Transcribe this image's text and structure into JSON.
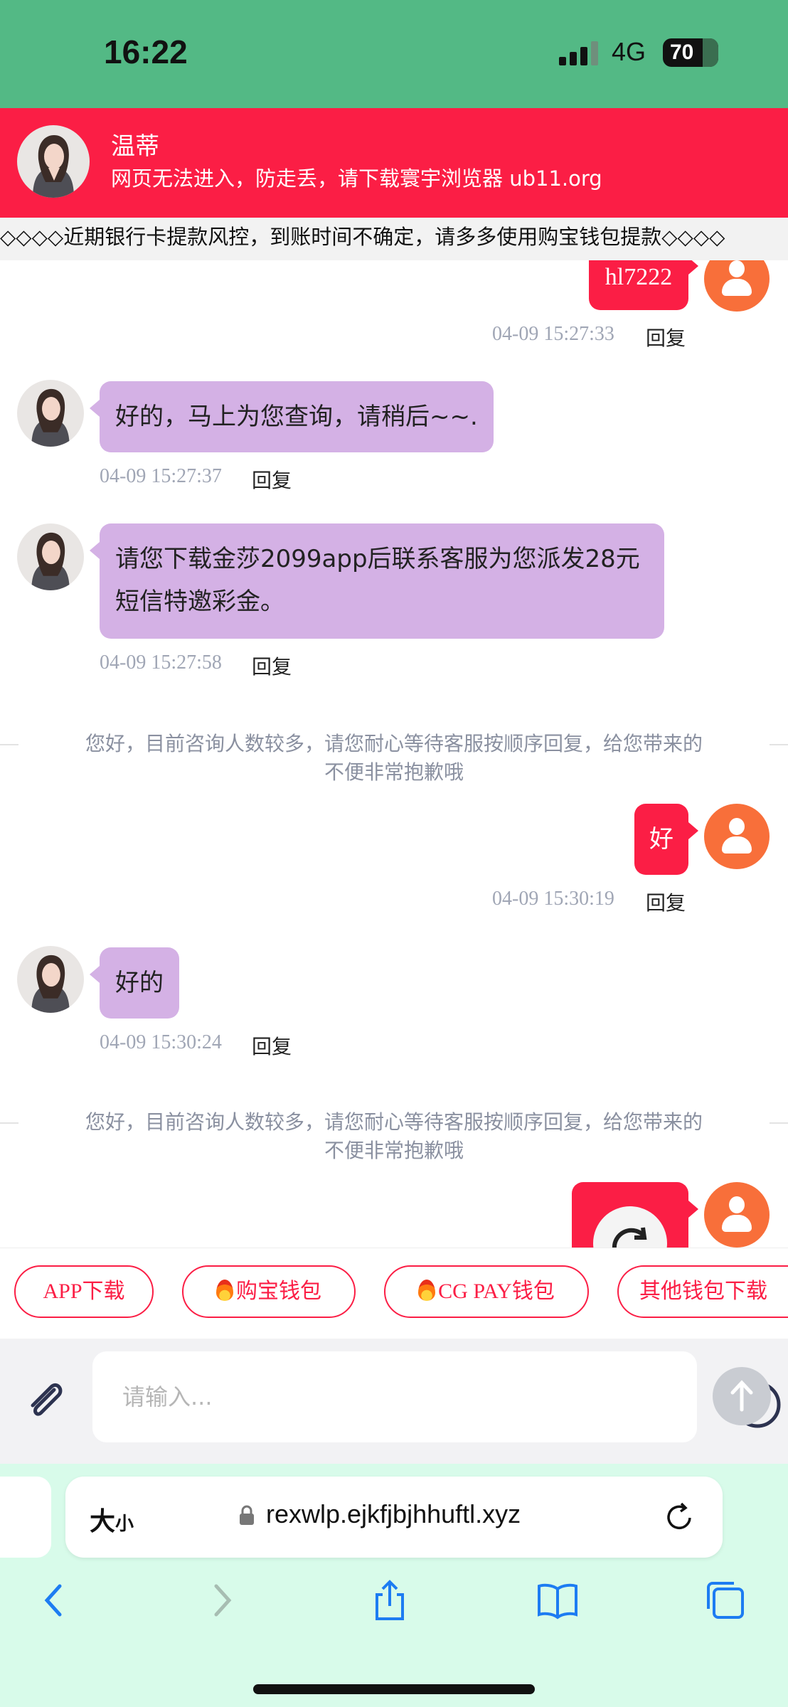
{
  "status": {
    "time": "16:22",
    "network": "4G",
    "battery": "70"
  },
  "header": {
    "agent_name": "温蒂",
    "notice": "网页无法进入，防走丢，请下载寰宇浏览器 ub11.org"
  },
  "marquee": "◇◇◇◇近期银行卡提款风控，到账时间不确定，请多多使用购宝钱包提款◇◇◇◇",
  "messages": {
    "m1": {
      "text": "hl7222",
      "time": "04-09 15:27:33",
      "reply": "回复"
    },
    "m2": {
      "text": "好的，马上为您查询，请稍后~~.",
      "time": "04-09 15:27:37",
      "reply": "回复"
    },
    "m3": {
      "line1": "请您下载金莎2099app后联系客服为您派发28元",
      "line2": "短信特邀彩金。",
      "time": "04-09 15:27:58",
      "reply": "回复"
    },
    "sys1": {
      "line1": "您好，目前咨询人数较多，请您耐心等待客服按顺序回复，给您带来的",
      "line2": "不便非常抱歉哦"
    },
    "m4": {
      "text": "好",
      "time": "04-09 15:30:19",
      "reply": "回复"
    },
    "m5": {
      "text": "好的",
      "time": "04-09 15:30:24",
      "reply": "回复"
    },
    "sys2": {
      "line1": "您好，目前咨询人数较多，请您耐心等待客服按顺序回复，给您带来的",
      "line2": "不便非常抱歉哦"
    }
  },
  "quick_buttons": {
    "b1": "APP下载",
    "b2": "购宝钱包",
    "b3": "CG PAY钱包",
    "b4": "其他钱包下载"
  },
  "input": {
    "placeholder": "请输入..."
  },
  "browser": {
    "aa_big": "大",
    "aa_small": "小",
    "url": "rexwlp.ejkfjbjhhuftl.xyz"
  },
  "icons": {
    "attach": "paperclip-icon",
    "emoji": "smiley-icon",
    "send": "arrow-up-icon",
    "back": "chevron-left-icon",
    "forward": "chevron-right-icon",
    "share": "share-icon",
    "bookmarks": "book-icon",
    "tabs": "tabs-icon"
  },
  "colors": {
    "status_bar": "#53b985",
    "header": "#fb1e45",
    "agent_bubble": "#d4b1e5",
    "user_bubble": "#fb1e45",
    "user_avatar": "#f86f3a",
    "browser_bg": "#d8fbea"
  }
}
